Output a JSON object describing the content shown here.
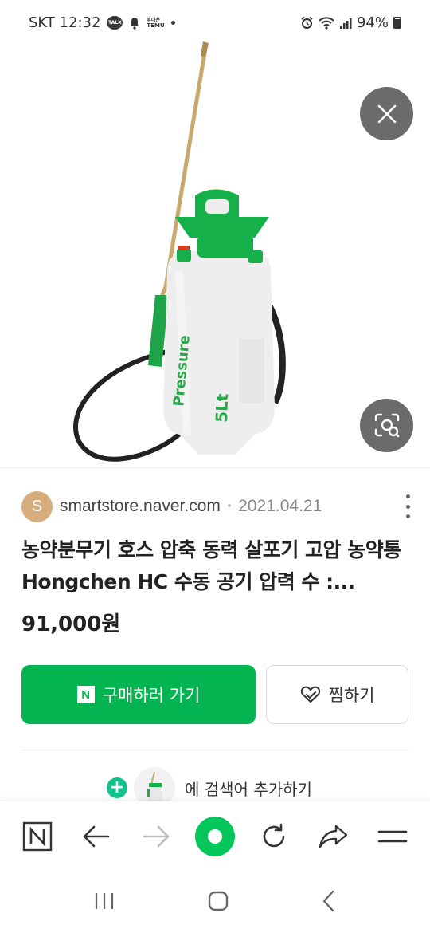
{
  "status_bar": {
    "carrier_time": "SKT 12:32",
    "talk_badge": "TALK",
    "temu_badge_top": "휴대폰",
    "temu_badge_bottom": "TEMU",
    "battery": "94%"
  },
  "viewer": {
    "close_icon": "close-icon",
    "lens_icon": "image-search-icon",
    "product_label_text": "5Lt"
  },
  "result": {
    "source": {
      "avatar_letter": "S",
      "domain": "smartstore.naver.com",
      "separator": "•",
      "date": "2021.04.21"
    },
    "title": "농약분무기 호스 압축 동력 살포기 고압 농약통 Hongchen HC 수동 공기 압력 수 :...",
    "price": "91,000원",
    "buy_button": {
      "badge": "N",
      "label": "구매하러 가기"
    },
    "wish_button": {
      "label": "찜하기"
    },
    "add_keyword": {
      "label": "에 검색어 추가하기"
    }
  },
  "colors": {
    "naver_green": "#03b451",
    "fab_gray": "#6b6b6b",
    "avatar": "#d8ad7e"
  }
}
